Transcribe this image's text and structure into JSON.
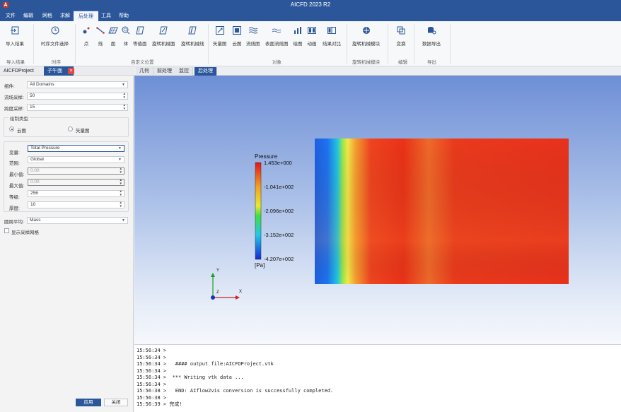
{
  "app": {
    "title": "AICFD 2023 R2",
    "logo_icon": "app-logo-icon"
  },
  "menu": {
    "items": [
      "文件",
      "编辑",
      "网格",
      "求解",
      "后处理",
      "工具",
      "帮助"
    ],
    "active": "后处理"
  },
  "ribbon": {
    "buttons": [
      {
        "label": "导入结果",
        "icon": "import-result-icon"
      },
      {
        "label": "时序文件选择",
        "icon": "clock-icon"
      },
      {
        "label": "点",
        "icon": "point-icon"
      },
      {
        "label": "线",
        "icon": "line-icon"
      },
      {
        "label": "面",
        "icon": "plane-icon"
      },
      {
        "label": "体",
        "icon": "volume-icon"
      },
      {
        "label": "等值面",
        "icon": "isosurface-icon"
      },
      {
        "label": "旋转机械面",
        "icon": "turbo-surface-icon"
      },
      {
        "label": "旋转机械线",
        "icon": "turbo-line-icon"
      },
      {
        "label": "矢量图",
        "icon": "vector-icon"
      },
      {
        "label": "云图",
        "icon": "contour-icon"
      },
      {
        "label": "流线图",
        "icon": "streamline-icon"
      },
      {
        "label": "表面流线图",
        "icon": "surface-streamline-icon"
      },
      {
        "label": "绘图",
        "icon": "chart-icon"
      },
      {
        "label": "动画",
        "icon": "animation-icon"
      },
      {
        "label": "结果对比",
        "icon": "compare-icon"
      },
      {
        "label": "旋转机械模块",
        "icon": "turbo-module-icon"
      },
      {
        "label": "变换",
        "icon": "transform-icon"
      },
      {
        "label": "数据导出",
        "icon": "data-export-icon"
      }
    ],
    "groups": [
      "导入结果",
      "时序",
      "自定义位置",
      "对象",
      "旋转机械模块",
      "编辑",
      "导出"
    ]
  },
  "left_panel": {
    "tabs": [
      "AICFDProject",
      "子午面"
    ],
    "fields": {
      "domain_label": "组件:",
      "domain_value": "All Domains",
      "stream_label": "流场采样:",
      "stream_value": "50",
      "span_label": "跨度采样:",
      "span_value": "15"
    },
    "plot_type": {
      "title": "绘制类型",
      "options": [
        "云图",
        "矢量图"
      ],
      "selected": "云图"
    },
    "contour": {
      "variable_label": "变量:",
      "variable_value": "Total Pressure",
      "range_label": "范围:",
      "range_value": "Global",
      "min_label": "最小值:",
      "min_value": "0.00",
      "max_label": "最大值:",
      "max_value": "0.00",
      "levels_label": "等级:",
      "levels_value": "256",
      "thickness_label": "厚度:",
      "thickness_value": "10"
    },
    "circ_avg_label": "圆周平均:",
    "circ_avg_value": "Mass",
    "show_mesh_label": "显示采样网格",
    "apply_label": "应用",
    "close_label": "关闭"
  },
  "view_tabs": {
    "items": [
      "几何",
      "前处理",
      "监控",
      "后处理"
    ],
    "active": "后处理"
  },
  "legend": {
    "title": "Pressure",
    "ticks": [
      "1.453e+000",
      "-1.041e+002",
      "-2.096e+002",
      "-3.152e+002",
      "-4.207e+002"
    ],
    "unit": "[Pa]"
  },
  "axes": {
    "x": "X",
    "y": "Y",
    "z": "Z"
  },
  "console": {
    "lines": [
      "15:56:34 >",
      "15:56:34 >",
      "15:56:34 >   #### output file:AICFDProject.vtk",
      "15:56:34 >",
      "15:56:34 >  *** Writing vtk data ...",
      "15:56:34 >",
      "15:56:38 >   END: AIflow2vis conversion is successfully completed.",
      "15:56:38 >",
      "15:56:39 > 完成!"
    ]
  },
  "colors": {
    "accent": "#2b579a",
    "close_tab": "#e04848"
  }
}
